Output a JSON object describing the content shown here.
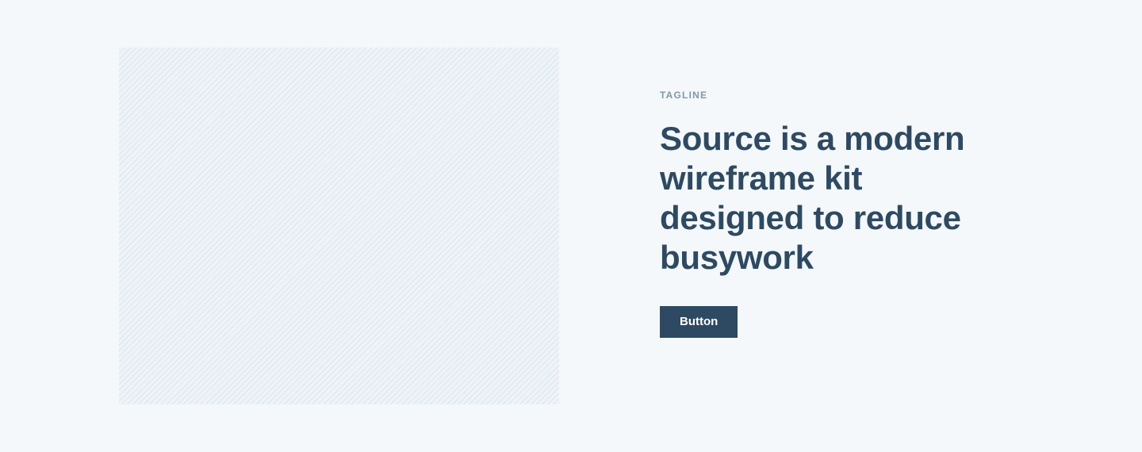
{
  "hero": {
    "tagline": "TAGLINE",
    "headline": "Source is a modern wireframe kit designed to reduce busywork",
    "button_label": "Button"
  },
  "colors": {
    "background": "#f4f8fb",
    "heading": "#2e4a62",
    "tagline": "#8296a8",
    "button_bg": "#2e4a62",
    "button_text": "#ffffff",
    "placeholder_stripes": "#cdd9e5"
  }
}
